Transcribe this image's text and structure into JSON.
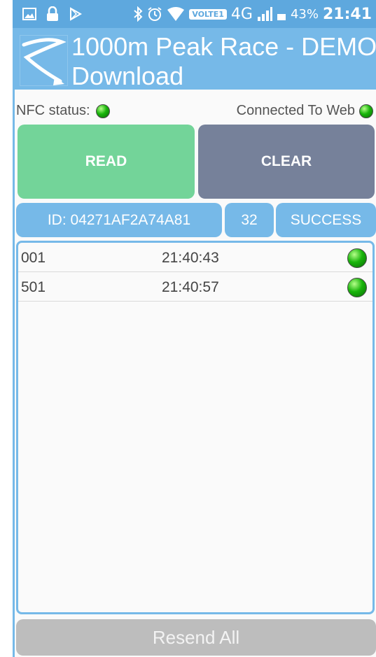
{
  "statusbar": {
    "icons": [
      "gallery-icon",
      "lock-icon",
      "play-store-icon",
      "bluetooth-icon",
      "alarm-icon",
      "wifi-icon"
    ],
    "volte": "VOLTE1",
    "network": "4G",
    "battery": "43%",
    "time": "21:41"
  },
  "appbar": {
    "title_line1": "1000m Peak Race - DEMO",
    "title_line2": "Download"
  },
  "status": {
    "nfc_label": "NFC status:",
    "web_label": "Connected To Web"
  },
  "buttons": {
    "read": "READ",
    "clear": "CLEAR"
  },
  "info": {
    "id": "ID: 04271AF2A74A81",
    "count": "32",
    "result": "SUCCESS"
  },
  "rows": [
    {
      "id": "001",
      "time": "21:40:43"
    },
    {
      "id": "501",
      "time": "21:40:57"
    }
  ],
  "resend": "Resend All",
  "colors": {
    "statusbar": "#5ea8de",
    "appbar": "#76b9e8",
    "read": "#73d499",
    "clear": "#76819a",
    "led_green": "#19b50b"
  }
}
